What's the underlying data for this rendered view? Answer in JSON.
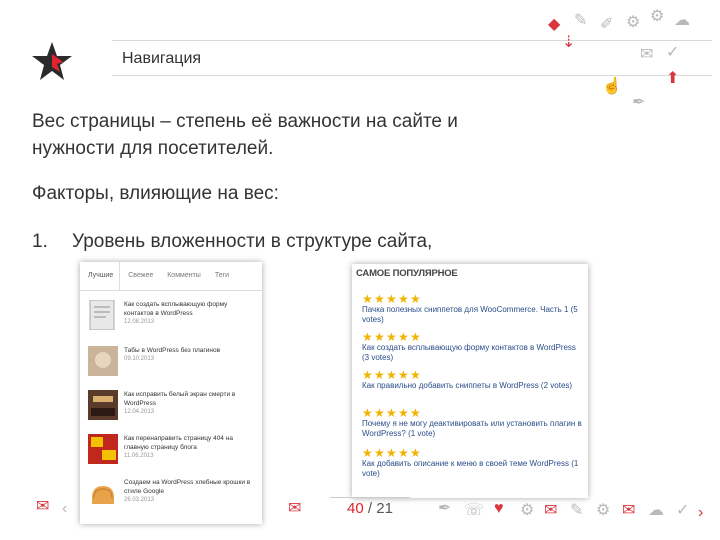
{
  "header": {
    "title": "Навигация"
  },
  "content": {
    "paragraph1": "Вес страницы – степень её важности на сайте и нужности для посетителей.",
    "paragraph2": "Факторы, влияющие на вес:",
    "list": [
      {
        "num": "1.",
        "text": "Уровень вложенности в структуре сайта,"
      }
    ]
  },
  "widget_left": {
    "tabs": [
      "Лучшие",
      "Свежее",
      "Комменты",
      "Теги"
    ],
    "items": [
      {
        "title": "Как создать всплывающую форму контактов в WordPress",
        "date": "12.08.2013"
      },
      {
        "title": "Табы в WordPress без плагинов",
        "date": "09.10.2013"
      },
      {
        "title": "Как исправить белый экран смерти в WordPress",
        "date": "12.04.2013"
      },
      {
        "title": "Как перенаправить страницу 404 на главную страницу блога",
        "date": "11.06.2013"
      },
      {
        "title": "Создаем на WordPress хлебные крошки в стиле Google",
        "date": "26.03.2013"
      }
    ]
  },
  "widget_right": {
    "heading": "САМОЕ ПОПУЛЯРНОЕ",
    "items": [
      {
        "rating": 5,
        "text": "Пачка полезных сниппетов для WooCommerce. Часть 1 (5 votes)"
      },
      {
        "rating": 5,
        "text": "Как создать всплывающую форму контактов в WordPress (3 votes)"
      },
      {
        "rating": 5,
        "text": "Как правильно добавить сниппеты в WordPress (2 votes)"
      },
      {
        "rating": 5,
        "text": "Почему я не могу деактивировать или установить плагин в WordPress? (1 vote)"
      },
      {
        "rating": 5,
        "text": "Как добавить описание к меню в своей теме WordPress (1 vote)"
      }
    ]
  },
  "pager": {
    "current": "40",
    "separator": "/",
    "total": "21"
  },
  "colors": {
    "accent": "#e0232e",
    "logo_dark": "#2b2b2b",
    "star": "#f0b400"
  }
}
